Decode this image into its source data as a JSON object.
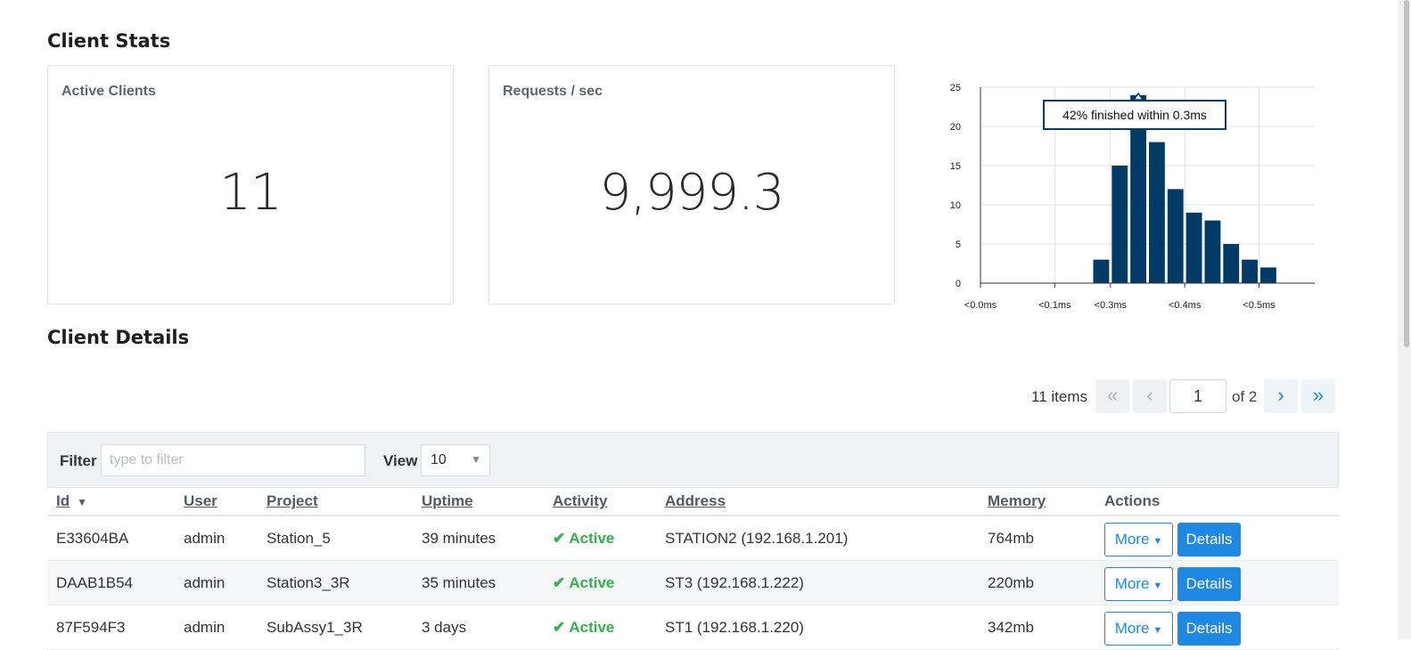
{
  "stats": {
    "title": "Client Stats",
    "active_clients_label": "Active Clients",
    "active_clients_value": "11",
    "requests_label": "Requests / sec",
    "requests_value": "9,999.3"
  },
  "chart_data": {
    "type": "bar",
    "categories": [
      "<0.0ms",
      "",
      "",
      "",
      "<0.1ms",
      "",
      "",
      "<0.3ms",
      "",
      "",
      "",
      "<0.4ms",
      "",
      "",
      "",
      "<0.5ms",
      "",
      ""
    ],
    "values": [
      0,
      0,
      0,
      0,
      0,
      0,
      3,
      15,
      24,
      18,
      12,
      9,
      8,
      5,
      3,
      2,
      0,
      0
    ],
    "x_tick_labels": [
      "<0.0ms",
      "<0.1ms",
      "<0.3ms",
      "<0.4ms",
      "<0.5ms"
    ],
    "y_ticks": [
      0,
      5,
      10,
      15,
      20,
      25
    ],
    "ylim": [
      0,
      25
    ],
    "tooltip": "42% finished within 0.3ms",
    "bar_color": "#003a66",
    "grid": true
  },
  "details": {
    "title": "Client Details",
    "items_count": "11 items",
    "pager": {
      "first": "«",
      "prev": "‹",
      "page": "1",
      "of": "of 2",
      "next": "›",
      "last": "»"
    },
    "filter_label": "Filter",
    "filter_placeholder": "type to filter",
    "view_label": "View",
    "view_value": "10",
    "columns": [
      "Id",
      "User",
      "Project",
      "Uptime",
      "Activity",
      "Address",
      "Memory",
      "Actions"
    ],
    "rows": [
      {
        "id": "E33604BA",
        "user": "admin",
        "project": "Station_5",
        "uptime": "39 minutes",
        "activity": "Active",
        "address": "STATION2 (192.168.1.201)",
        "memory": "764mb"
      },
      {
        "id": "DAAB1B54",
        "user": "admin",
        "project": "Station3_3R",
        "uptime": "35 minutes",
        "activity": "Active",
        "address": "ST3 (192.168.1.222)",
        "memory": "220mb"
      },
      {
        "id": "87F594F3",
        "user": "admin",
        "project": "SubAssy1_3R",
        "uptime": "3 days",
        "activity": "Active",
        "address": "ST1 (192.168.1.220)",
        "memory": "342mb"
      }
    ],
    "more_label": "More",
    "details_label": "Details"
  },
  "colors": {
    "accent": "#1e88e5",
    "active": "#2fb34a",
    "bar": "#003a66"
  }
}
